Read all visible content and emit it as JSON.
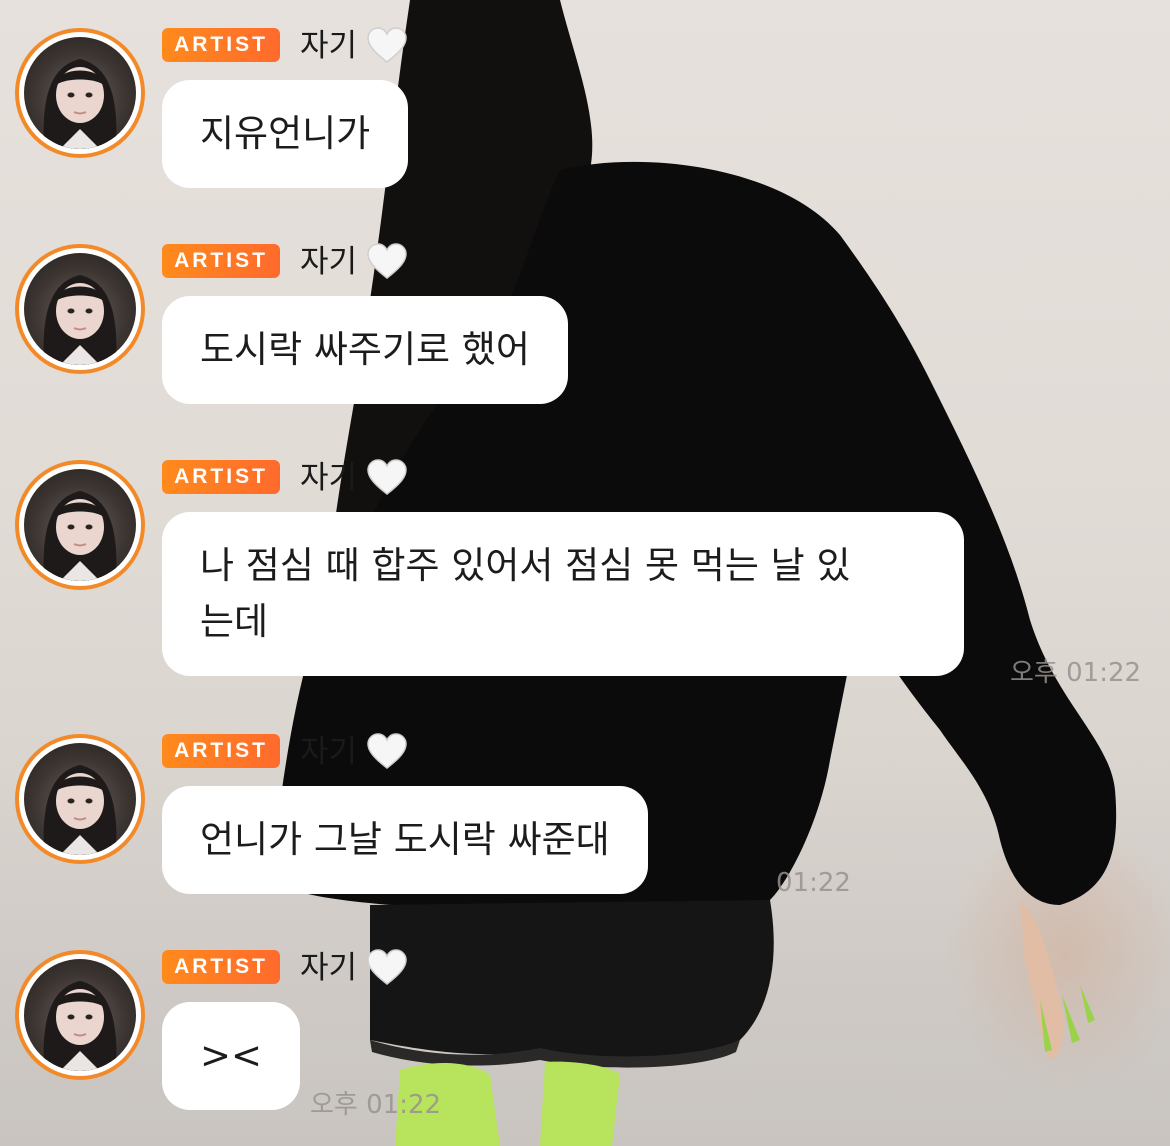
{
  "messages": [
    {
      "badge": "ARTIST",
      "name": "자기",
      "text": "지유언니가",
      "time": ""
    },
    {
      "badge": "ARTIST",
      "name": "자기",
      "text": "도시락 싸주기로 했어",
      "time": ""
    },
    {
      "badge": "ARTIST",
      "name": "자기",
      "text": "나 점심 때 합주 있어서 점심 못 먹는 날 있\n는데",
      "time": "오후 01:22"
    },
    {
      "badge": "ARTIST",
      "name": "자기",
      "text": "언니가 그날 도시락 싸준대",
      "time": "01:22"
    },
    {
      "badge": "ARTIST",
      "name": "자기",
      "text": "><",
      "time": "오후 01:22"
    }
  ],
  "icons": {
    "avatar": "profile-photo",
    "heart": "white-heart-icon"
  },
  "colors": {
    "badge": "#ff7a22",
    "avatar_ring": "#f28a2a",
    "bubble": "#ffffff",
    "text": "#1c1c1c"
  }
}
